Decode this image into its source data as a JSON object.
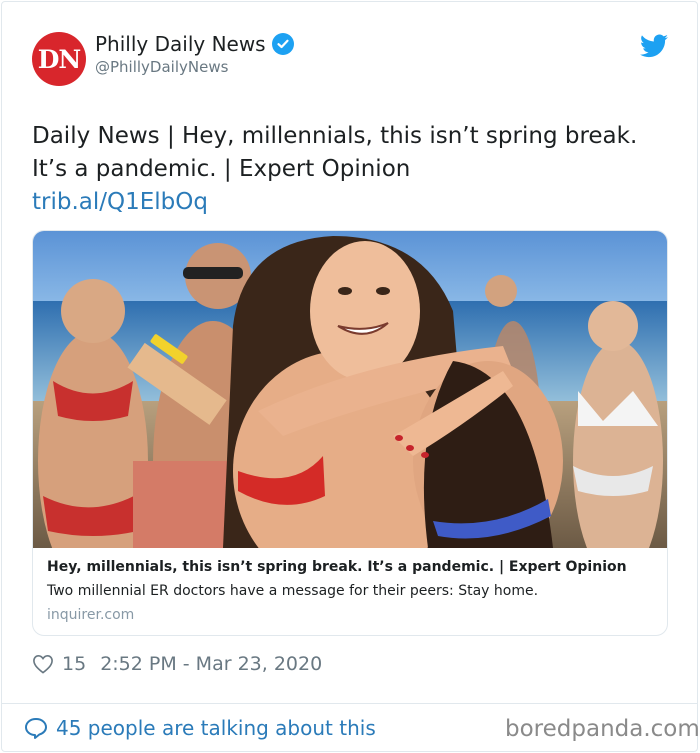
{
  "account": {
    "avatar_text": "DN",
    "name": "Philly Daily News",
    "handle": "@PhillyDailyNews",
    "verified_icon": "verified-badge-icon",
    "brand_color": "#d8262c"
  },
  "tweet": {
    "text": "Daily News |  Hey, millennials, this isn’t spring break. It’s a pandemic. | Expert Opinion",
    "link": "trib.al/Q1ElbOq"
  },
  "link_card": {
    "title": "Hey, millennials, this isn’t spring break. It’s a pandemic. | Expert Opinion",
    "description": "Two millennial ER doctors have a message for their peers: Stay home.",
    "domain": "inquirer.com"
  },
  "meta": {
    "likes": "15",
    "timestamp": "2:52 PM - Mar 23, 2020"
  },
  "footer": {
    "talking": "45 people are talking about this"
  },
  "watermark": "boredpanda.com",
  "colors": {
    "link": "#2b7bb9",
    "twitter_blue": "#1da1f2"
  }
}
